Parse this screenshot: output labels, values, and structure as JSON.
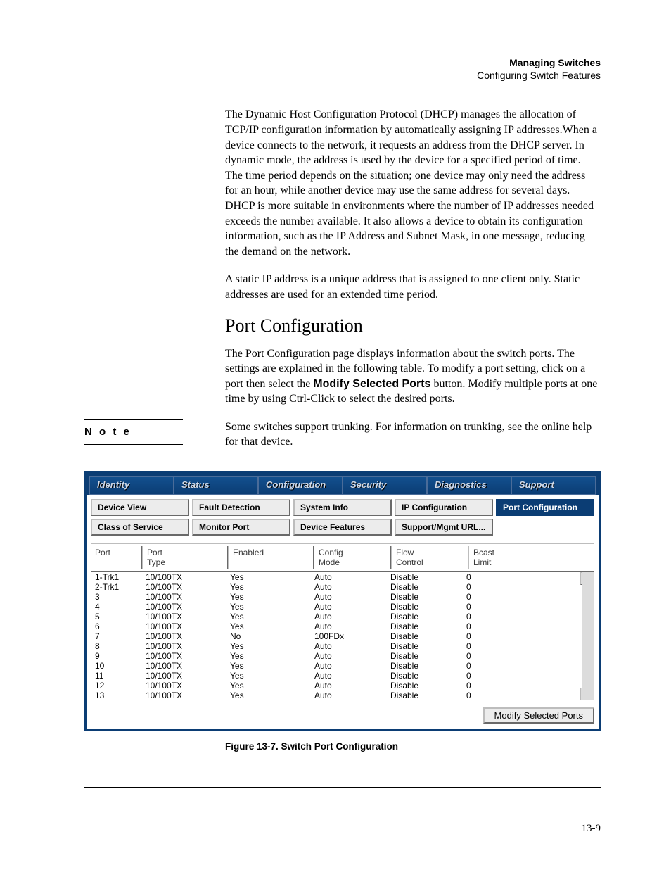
{
  "header": {
    "title": "Managing Switches",
    "subtitle": "Configuring Switch Features"
  },
  "para1": "The Dynamic Host Configuration Protocol (DHCP) manages the allocation of TCP/IP configuration information by automatically assigning IP addresses.When a device connects to the network, it requests an address from the DHCP server. In dynamic mode, the address is used by the device for a specified period of time. The time period depends on the situation; one device may only need the address for an hour, while another device may use the same address for several days. DHCP is more suitable in environments where the number of IP addresses needed exceeds the number available. It also allows a device to obtain its configuration information, such as the IP Address and Subnet Mask, in one message, reducing the demand on the network.",
  "para2": "A static IP address is a unique address that is assigned to one client only. Static addresses are used for an extended time period.",
  "section_title": "Port Configuration",
  "para3a": "The Port Configuration page displays information about the switch ports. The settings are explained in the following table. To modify a port setting, click on a port then select the ",
  "para3_bold": "Modify Selected Ports",
  "para3b": " button. Modify multiple ports at one time by using Ctrl-Click to select the desired ports.",
  "note_label": "N o t e",
  "note_body": "Some switches support trunking. For information on trunking, see the online help for that device.",
  "tabs": {
    "identity": "Identity",
    "status": "Status",
    "configuration": "Configuration",
    "security": "Security",
    "diagnostics": "Diagnostics",
    "support": "Support"
  },
  "subtabs": {
    "device_view": "Device View",
    "fault_detection": "Fault Detection",
    "system_info": "System Info",
    "ip_config": "IP Configuration",
    "port_config": "Port Configuration",
    "class_of_service": "Class of Service",
    "monitor_port": "Monitor Port",
    "device_features": "Device Features",
    "support_url": "Support/Mgmt URL..."
  },
  "grid": {
    "headers": {
      "port": "Port",
      "port_type": "Port\nType",
      "enabled": "Enabled",
      "config_mode": "Config\nMode",
      "flow_control": "Flow\nControl",
      "bcast_limit": "Bcast\nLimit"
    },
    "rows": [
      {
        "port": "1-Trk1",
        "type": "10/100TX",
        "en": "Yes",
        "mode": "Auto",
        "flow": "Disable",
        "bcast": "0"
      },
      {
        "port": "2-Trk1",
        "type": "10/100TX",
        "en": "Yes",
        "mode": "Auto",
        "flow": "Disable",
        "bcast": "0"
      },
      {
        "port": "3",
        "type": "10/100TX",
        "en": "Yes",
        "mode": "Auto",
        "flow": "Disable",
        "bcast": "0"
      },
      {
        "port": "4",
        "type": "10/100TX",
        "en": "Yes",
        "mode": "Auto",
        "flow": "Disable",
        "bcast": "0"
      },
      {
        "port": "5",
        "type": "10/100TX",
        "en": "Yes",
        "mode": "Auto",
        "flow": "Disable",
        "bcast": "0"
      },
      {
        "port": "6",
        "type": "10/100TX",
        "en": "Yes",
        "mode": "Auto",
        "flow": "Disable",
        "bcast": "0"
      },
      {
        "port": "7",
        "type": "10/100TX",
        "en": "No",
        "mode": "100FDx",
        "flow": "Disable",
        "bcast": "0"
      },
      {
        "port": "8",
        "type": "10/100TX",
        "en": "Yes",
        "mode": "Auto",
        "flow": "Disable",
        "bcast": "0"
      },
      {
        "port": "9",
        "type": "10/100TX",
        "en": "Yes",
        "mode": "Auto",
        "flow": "Disable",
        "bcast": "0"
      },
      {
        "port": "10",
        "type": "10/100TX",
        "en": "Yes",
        "mode": "Auto",
        "flow": "Disable",
        "bcast": "0"
      },
      {
        "port": "11",
        "type": "10/100TX",
        "en": "Yes",
        "mode": "Auto",
        "flow": "Disable",
        "bcast": "0"
      },
      {
        "port": "12",
        "type": "10/100TX",
        "en": "Yes",
        "mode": "Auto",
        "flow": "Disable",
        "bcast": "0"
      },
      {
        "port": "13",
        "type": "10/100TX",
        "en": "Yes",
        "mode": "Auto",
        "flow": "Disable",
        "bcast": "0"
      }
    ]
  },
  "modify_button": "Modify Selected Ports",
  "caption": "Figure 13-7.  Switch Port Configuration",
  "page_number": "13-9"
}
